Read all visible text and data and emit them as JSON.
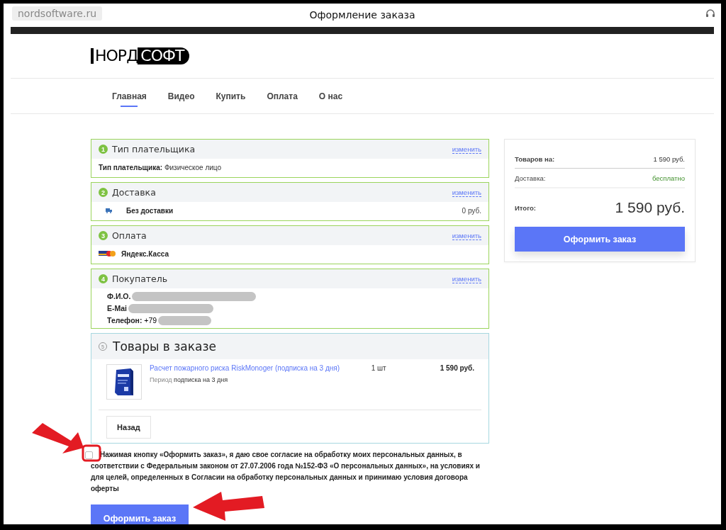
{
  "browser": {
    "site": "nordsoftware.ru",
    "title": "Оформление заказа"
  },
  "logo": {
    "left": "НОРД",
    "right": "СОФТ"
  },
  "nav": [
    {
      "label": "Главная",
      "selected": true
    },
    {
      "label": "Видео",
      "selected": false
    },
    {
      "label": "Купить",
      "selected": false
    },
    {
      "label": "Оплата",
      "selected": false
    },
    {
      "label": "О нас",
      "selected": false
    }
  ],
  "sections": [
    {
      "kind": "payer",
      "number": "1",
      "title": "Тип плательщика",
      "edit": "изменить",
      "label": "Тип плательщика:",
      "value": "Физическое лицо"
    },
    {
      "kind": "delivery",
      "number": "2",
      "title": "Доставка",
      "edit": "изменить",
      "name": "Без доставки",
      "price": "0 руб."
    },
    {
      "kind": "payment",
      "number": "3",
      "title": "Оплата",
      "edit": "изменить",
      "name": "Яндекс.Касса"
    },
    {
      "kind": "buyer",
      "number": "4",
      "title": "Покупатель",
      "edit": "изменить",
      "fields": [
        {
          "label": "Ф.И.О.",
          "redacted": true
        },
        {
          "label": "E-Mai",
          "redacted": true
        },
        {
          "label": "Телефон:",
          "value": "+79",
          "redacted": true
        }
      ]
    }
  ],
  "cart": {
    "number": "5",
    "title": "Товары в заказе",
    "items": [
      {
        "name": "Расчет пожарного риска RiskMonoger (подписка на 3 дня)",
        "period_label": "Период",
        "period_value": "подписка на 3 дня",
        "qty": "1 шт",
        "price": "1 590 руб."
      }
    ],
    "back": "Назад"
  },
  "consent": {
    "checked": false,
    "text": "Нажимая кнопку «Оформить заказ», я даю свое согласие на обработку моих персональных данных, в соответствии с Федеральным законом от 27.07.2006 года №152-ФЗ «О персональных данных», на условиях и для целей, определенных в Согласии на обработку персональных данных и принимаю условия договора оферты"
  },
  "submit": "Оформить заказ",
  "summary": {
    "rows": [
      {
        "kind": "normal",
        "label": "Товаров на:",
        "value": "1 590 руб."
      },
      {
        "kind": "free",
        "label": "Доставка:",
        "value": "бесплатно"
      },
      {
        "kind": "total",
        "label": "Итого:",
        "value": "1 590 руб."
      }
    ],
    "button": "Оформить заказ"
  }
}
